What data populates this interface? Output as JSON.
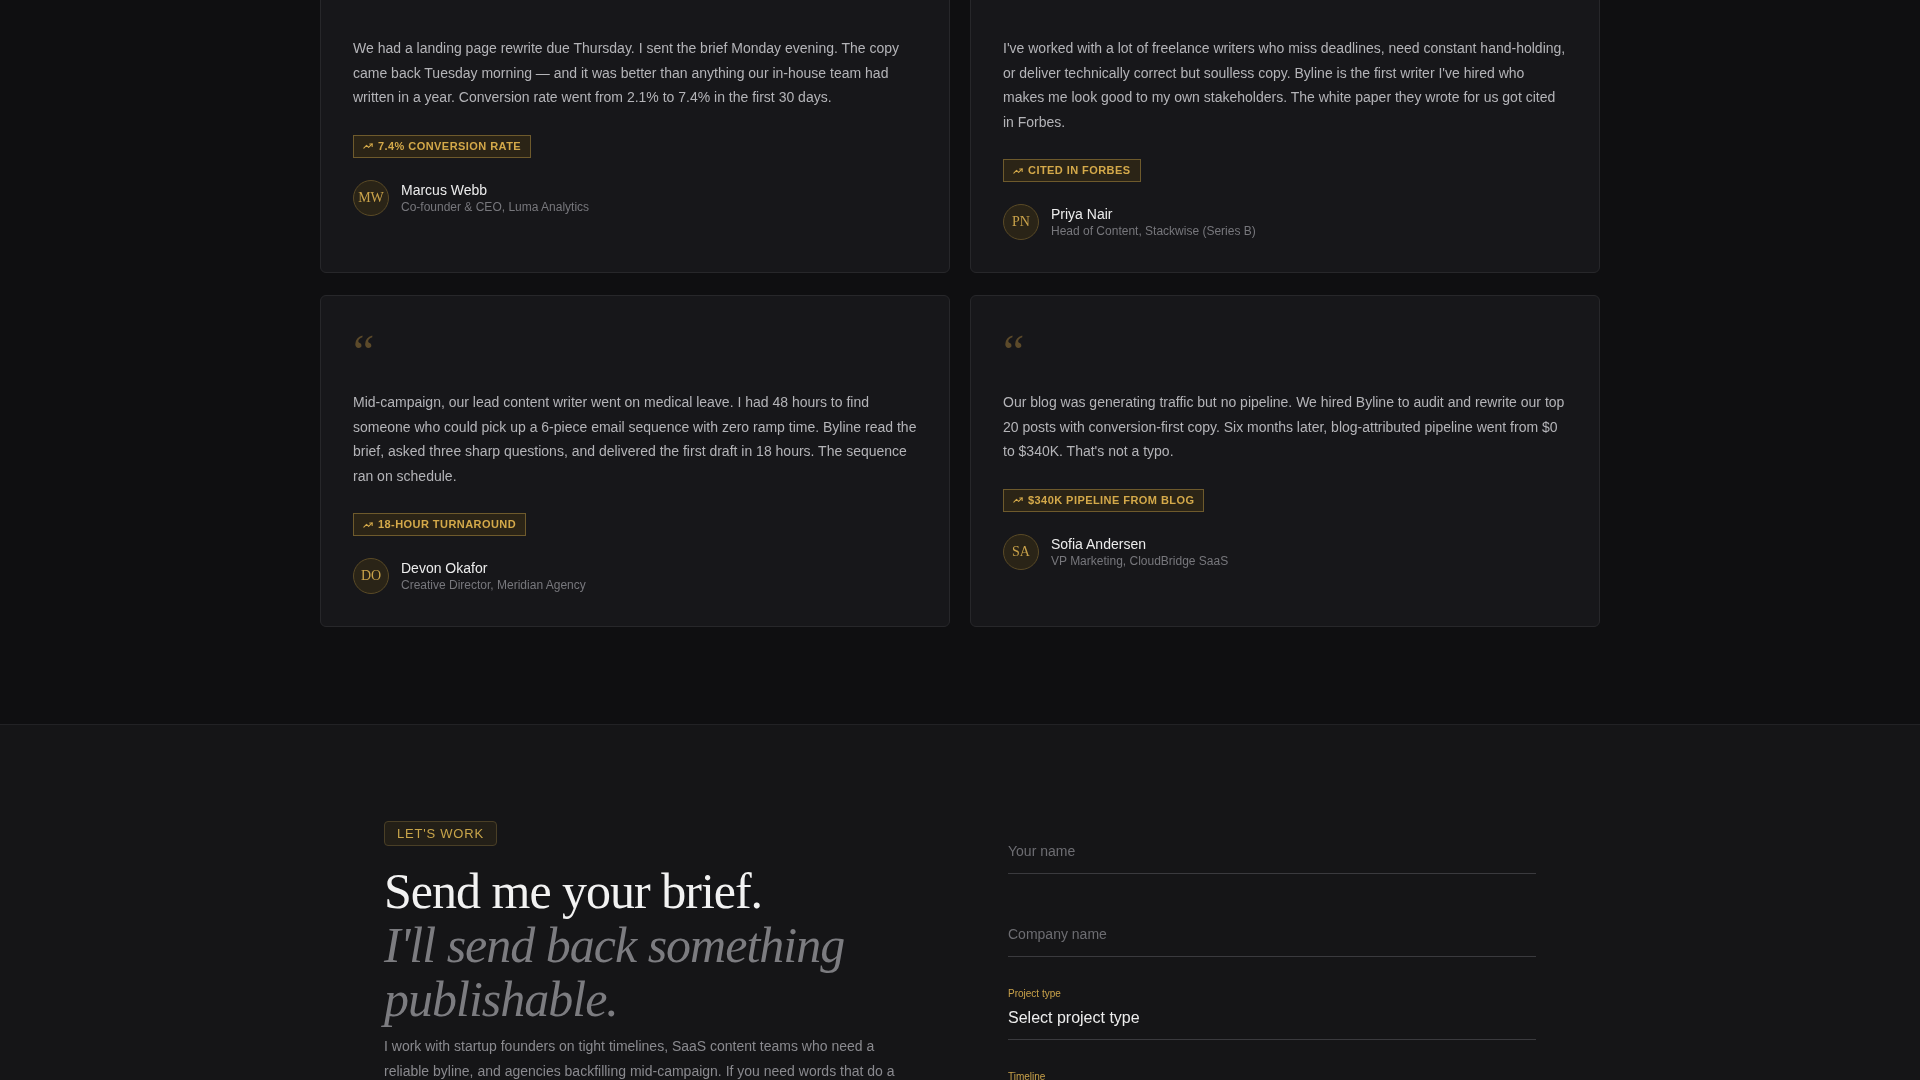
{
  "testimonials": [
    {
      "quote": "We had a landing page rewrite due Thursday. I sent the brief Monday evening. The copy came back Tuesday morning — and it was better than anything our in-house team had written in a year. Conversion rate went from 2.1% to 7.4% in the first 30 days.",
      "metric": "7.4% CONVERSION RATE",
      "author": {
        "initials": "MW",
        "name": "Marcus Webb",
        "role": "Co-founder & CEO, Luma Analytics"
      }
    },
    {
      "quote": "I've worked with a lot of freelance writers who miss deadlines, need constant hand-holding, or deliver technically correct but soulless copy. Byline is the first writer I've hired who makes me look good to my own stakeholders. The white paper they wrote for us got cited in Forbes.",
      "metric": "CITED IN FORBES",
      "author": {
        "initials": "PN",
        "name": "Priya Nair",
        "role": "Head of Content, Stackwise (Series B)"
      }
    },
    {
      "quote_mark": "“",
      "quote": "Mid-campaign, our lead content writer went on medical leave. I had 48 hours to find someone who could pick up a 6-piece email sequence with zero ramp time. Byline read the brief, asked three sharp questions, and delivered the first draft in 18 hours. The sequence ran on schedule.",
      "metric": "18-HOUR TURNAROUND",
      "author": {
        "initials": "DO",
        "name": "Devon Okafor",
        "role": "Creative Director, Meridian Agency"
      }
    },
    {
      "quote_mark": "“",
      "quote": "Our blog was generating traffic but no pipeline. We hired Byline to audit and rewrite our top 20 posts with conversion-first copy. Six months later, blog-attributed pipeline went from $0 to $340K. That's not a typo.",
      "metric": "$340K PIPELINE FROM BLOG",
      "author": {
        "initials": "SA",
        "name": "Sofia Andersen",
        "role": "VP Marketing, CloudBridge SaaS"
      }
    }
  ],
  "contact": {
    "eyebrow": "LET'S WORK",
    "heading": "Send me your brief.",
    "heading_italic": "I'll send back something publishable.",
    "intro": "I work with startup founders on tight timelines, SaaS content teams who need a reliable byline, and agencies backfilling mid-campaign. If you need words that do a",
    "form": {
      "fields": [
        {
          "kind": "text",
          "placeholder": "Your name"
        },
        {
          "kind": "text",
          "placeholder": "Company name"
        },
        {
          "kind": "select",
          "label": "Project type",
          "value": "Select project type"
        },
        {
          "kind": "select",
          "label": "Timeline"
        }
      ]
    }
  }
}
